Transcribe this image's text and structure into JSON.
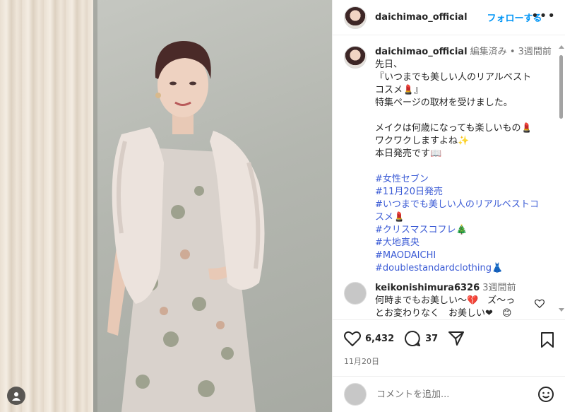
{
  "post": {
    "username": "daichimao_official",
    "follow_label": "フォローする",
    "more_label": "•••"
  },
  "caption": {
    "username": "daichimao_official",
    "edited": "編集済み",
    "separator": "•",
    "time": "3週間前",
    "lines": [
      "先日、",
      "『いつまでも美しい人のリアルベスト",
      "コスメ💄』",
      "特集ページの取材を受けました。",
      "",
      "メイクは何歳になっても楽しいもの💄",
      "ワクワクしますよね✨",
      "本日発売です📖"
    ],
    "hashtags": [
      "#女性セブン",
      "#11月20日発売",
      "#いつまでも美しい人のリアルベストコ",
      "スメ💄",
      "#クリスマスコフレ🎄",
      "#大地真央",
      "#MAODAICHI",
      "#doublestandardclothing👗"
    ]
  },
  "comment": {
    "username": "keikonishimura6326",
    "time": "3週間前",
    "text_line1": "何時までもお美しい〜💔　ズ〜っ",
    "text_line2": "とお変わりなく　お美しい❤　😊"
  },
  "actions": {
    "likes": "6,432",
    "comments": "37",
    "date": "11月20日"
  },
  "comment_box": {
    "placeholder": "コメントを追加..."
  },
  "icons": {
    "like": "heart-icon",
    "comment": "comment-bubble-icon",
    "share": "send-icon",
    "save": "bookmark-icon",
    "emoji": "smiley-icon",
    "more": "more-dots-icon"
  }
}
